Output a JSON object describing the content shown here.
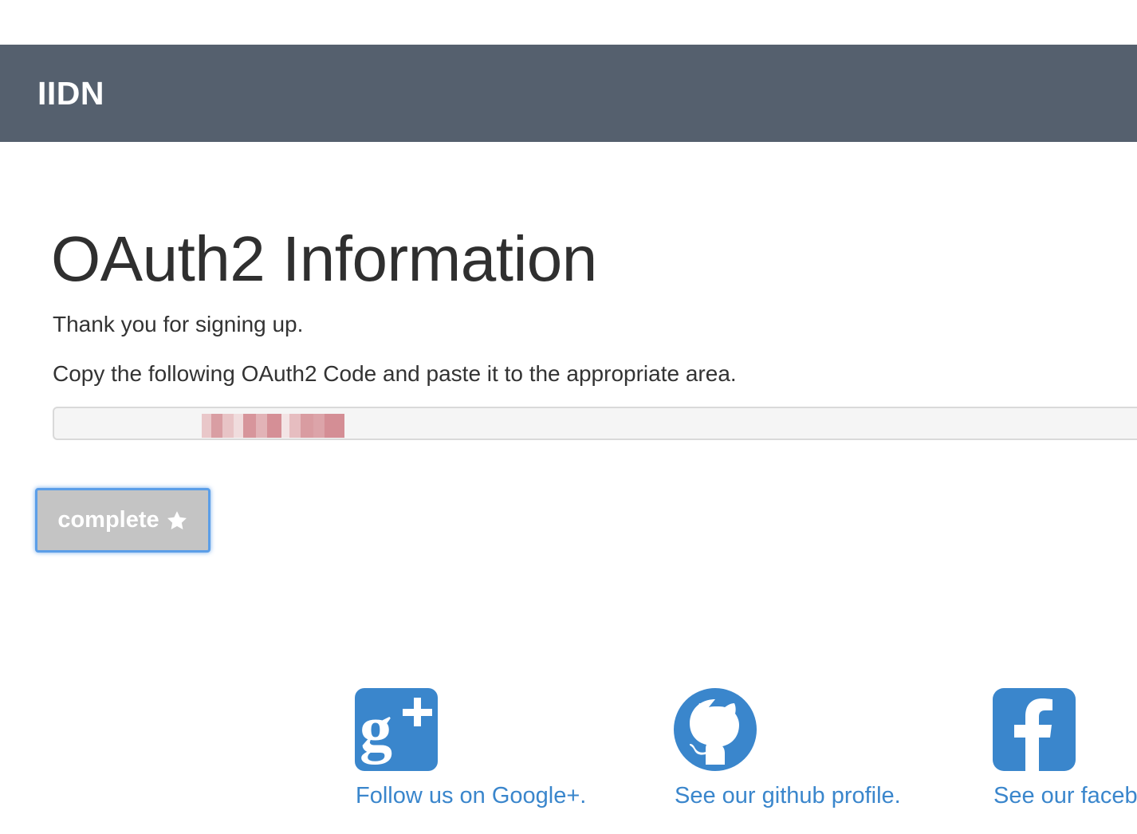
{
  "header": {
    "brand": "IIDN",
    "background_color": "#55606e"
  },
  "main": {
    "title": "OAuth2 Information",
    "thank_you": "Thank you for signing up.",
    "instruction": "Copy the following OAuth2 Code and paste it to the appropriate area.",
    "code_field": {
      "value": "",
      "redacted": true
    },
    "complete_button": {
      "label": "complete",
      "icon": "star-icon"
    }
  },
  "footer": {
    "accent_color": "#3a86cc",
    "links": [
      {
        "label": "Follow us on Google+.",
        "icon": "google-plus-icon"
      },
      {
        "label": "See our github profile.",
        "icon": "github-icon"
      },
      {
        "label": "See our facebook page.",
        "icon": "facebook-icon"
      }
    ]
  }
}
